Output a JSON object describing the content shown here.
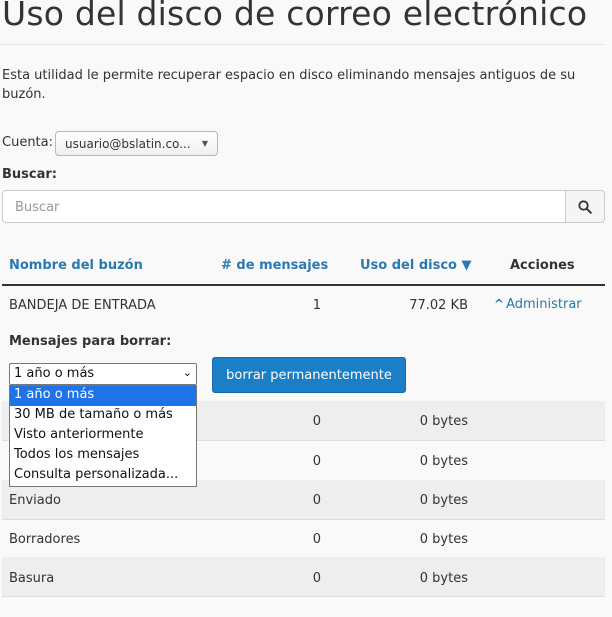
{
  "page": {
    "title": "Uso del disco de correo electrónico",
    "intro": "Esta utilidad le permite recuperar espacio en disco eliminando mensajes antiguos de su buzón."
  },
  "account": {
    "label": "Cuenta:",
    "selected": "usuario@bslatin.co..."
  },
  "search": {
    "label": "Buscar:",
    "placeholder": "Buscar",
    "icon": "search-icon"
  },
  "table": {
    "headers": {
      "mailbox": "Nombre del buzón",
      "messages": "# de mensajes",
      "disk": "Uso del disco ▼",
      "actions": "Acciones"
    },
    "rows": [
      {
        "name": "BANDEJA DE ENTRADA",
        "messages": "1",
        "disk": "77.02 KB",
        "action": "Administrar"
      },
      {
        "name": "",
        "messages": "0",
        "disk": "0 bytes"
      },
      {
        "name": "",
        "messages": "0",
        "disk": "0 bytes"
      },
      {
        "name": "Enviado",
        "messages": "0",
        "disk": "0 bytes"
      },
      {
        "name": "Borradores",
        "messages": "0",
        "disk": "0 bytes"
      },
      {
        "name": "Basura",
        "messages": "0",
        "disk": "0 bytes"
      }
    ]
  },
  "manage": {
    "label": "Mensajes para borrar:",
    "selected": "1 año o más",
    "options": [
      "1 año o más",
      "30 MB de tamaño o más",
      "Visto anteriormente",
      "Todos los mensajes",
      "Consulta personalizada..."
    ],
    "purge_button": "borrar permanentemente"
  },
  "colors": {
    "accent": "#1a7fc7",
    "link": "#2a7ab0",
    "selected_option": "#1e73e8",
    "row_band": "#eeeeee"
  }
}
